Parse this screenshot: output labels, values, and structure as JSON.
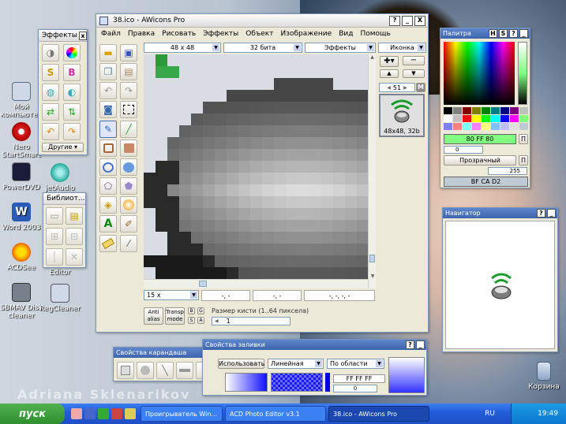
{
  "desktop": {
    "watermark": "Adriana Sklenarikov",
    "icons": [
      {
        "label": "Мой компьютер"
      },
      {
        "label": "Nero StartSmart"
      },
      {
        "label": "PowerDVD"
      },
      {
        "label": "Word 2003"
      },
      {
        "label": "ACDSee"
      },
      {
        "label": "SBMAV Disk cleaner"
      },
      {
        "label": "jetAudio"
      },
      {
        "label": "RegCleaner"
      },
      {
        "label": "Editor"
      },
      {
        "label": "Корзина"
      }
    ]
  },
  "effects_panel": {
    "title": "Эффекты",
    "others_label": "Другие"
  },
  "library_panel": {
    "title": "Библиот..."
  },
  "main_window": {
    "title": "38.ico - AWicons Pro",
    "menu": [
      "Файл",
      "Правка",
      "Рисовать",
      "Эффекты",
      "Объект",
      "Изображение",
      "Вид",
      "Помощь"
    ],
    "size_select": "48 x 48",
    "depth_select": "32 бита",
    "effects_select": "Эффекты",
    "icon_select": "Иконка",
    "frame_number": "51",
    "frame_caption": "48x48, 32b",
    "zoom": "15 x",
    "coord1": "-, -",
    "coord2": "-, -",
    "coord3": "-, -, -, -",
    "anti_alias": "Anti alias",
    "transp_mode": "Transp mode",
    "brush_label": "Размер кисти (1..64 пиксела)",
    "brush_value": "1"
  },
  "palette": {
    "title": "Палитра",
    "primary_hex": "80 FF 80",
    "transparent_label": "Прозрачный",
    "alpha_min": "0",
    "alpha_max": "255",
    "secondary_hex": "BF CA D2",
    "p_label": "П"
  },
  "navigator": {
    "title": "Навигатор"
  },
  "pencil_props": {
    "title": "Свойства карандаша"
  },
  "fill_props": {
    "title": "Свойства заливки",
    "use_label": "Использовать",
    "mode": "Линейная",
    "scope": "По области",
    "color_hex": "FF FF FF",
    "value": "0"
  },
  "taskbar": {
    "start": "пуск",
    "tasks": [
      "Проигрыватель Win...",
      "ACD Photo Editor v3.1",
      "38.ico - AWicons Pro"
    ],
    "lang": "RU",
    "clock": "19:49"
  }
}
